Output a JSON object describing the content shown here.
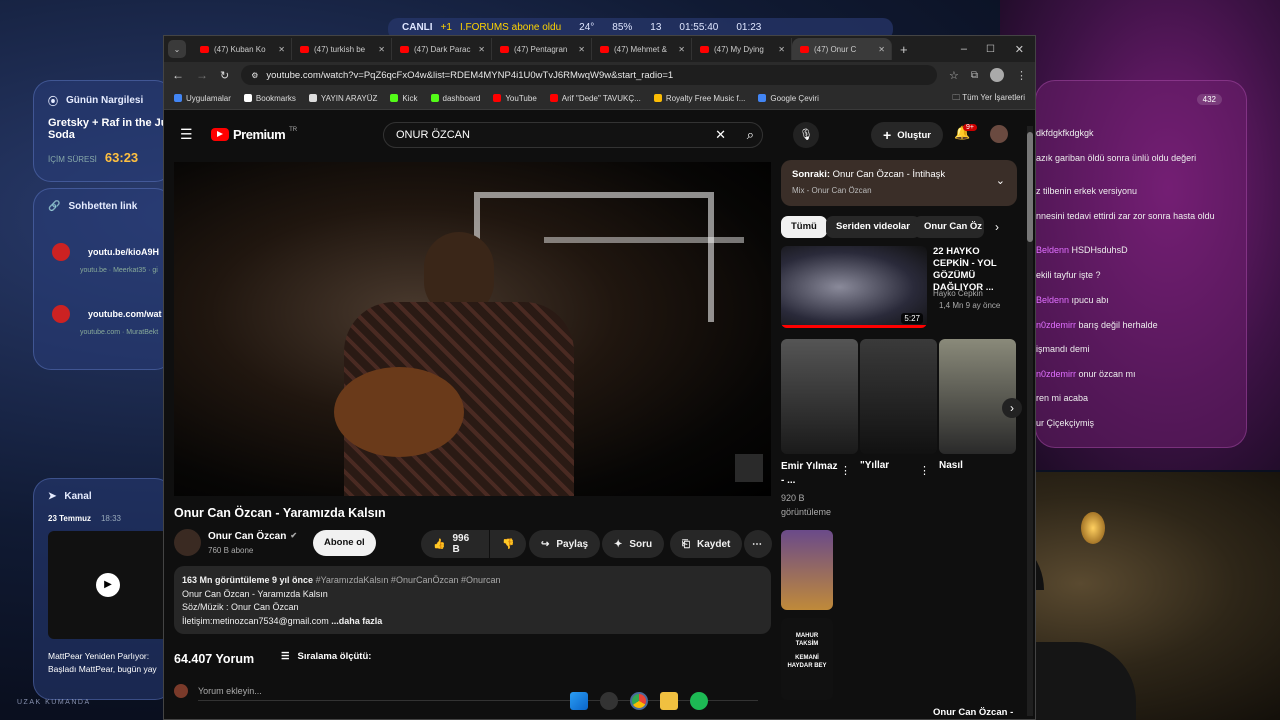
{
  "topbar": {
    "live": "CANLI",
    "plus": "+1",
    "follow": "I.FORUMS abone oldu",
    "temp": "24°",
    "humidity": "85%",
    "viewers": "13",
    "time1": "01:55:40",
    "time2": "01:23"
  },
  "widget_nargile": {
    "title": "Günün Nargilesi",
    "text1": "Gretsky + Raf in the Ju",
    "text2": "Soda",
    "duration_label": "İÇİM SÜRESİ",
    "duration": "63:23"
  },
  "widget_links": {
    "title": "Sohbetten link",
    "items": [
      {
        "url": "youtu.be/kioA9H",
        "meta": "youtu.be · Meerkat35 · gi"
      },
      {
        "url": "youtube.com/wat",
        "meta": "youtube.com · MuratBekt"
      }
    ]
  },
  "widget_kanal": {
    "title": "Kanal",
    "date": "23 Temmuz",
    "time": "18:33",
    "text1": "MattPear Yeniden Parlıyor: ",
    "text2": "Başladı MattPear, bugün yay"
  },
  "bottom_label": "UZAK KUMANDA",
  "browser": {
    "tabs": [
      "(47) Kuban Ko",
      "(47) turkish be",
      "(47) Dark Parac",
      "(47) Pentagran",
      "(47) Mehmet &",
      "(47) My Dying",
      "(47) Onur C"
    ],
    "url": "youtube.com/watch?v=PqZ6qcFxO4w&list=RDEM4MYNP4i1U0wTvJ6RMwqW9w&start_radio=1",
    "bookmarks": [
      "Uygulamalar",
      "Bookmarks",
      "YAYIN ARAYÜZ",
      "Kick",
      "dashboard",
      "YouTube",
      "Arif \"Dede\" TAVUKÇ...",
      "Royalty Free Music f...",
      "Google Çeviri"
    ],
    "all_bookmarks": "Tüm Yer İşaretleri"
  },
  "youtube": {
    "logo": "Premium",
    "logo_tr": "TR",
    "search_value": "ONUR ÖZCAN",
    "create": "Oluştur",
    "notif": "9+",
    "title": "Onur Can Özcan - Yaramızda Kalsın",
    "channel": "Onur Can Özcan",
    "subs": "760 B abone",
    "subscribe": "Abone ol",
    "likes": "996 B",
    "share": "Paylaş",
    "ask": "Soru",
    "save": "Kaydet",
    "desc_stats": "163 Mn görüntüleme  9 yıl önce",
    "desc_tags": "#YaramızdaKalsın #OnurCanÖzcan #Onurcan",
    "desc_lines": [
      "Onur Can Özcan - Yaramızda Kalsın",
      "Söz/Müzik : Onur Can Özcan",
      "İletişim:metinozcan7534@gmail.com"
    ],
    "desc_more": "...daha fazla",
    "comments_count": "64.407 Yorum",
    "sort": "Sıralama ölçütü:",
    "add_comment": "Yorum ekleyin...",
    "next_label": "Sonraki:",
    "next_title": "Onur Can Özcan - İntihaşk",
    "mix": "Mix - Onur Can Özcan",
    "chips": [
      "Tümü",
      "Seriden videolar",
      "Onur Can Öz"
    ],
    "rec1": {
      "title": "22 HAYKO CEPKİN - YOL GÖZÜMÜ DAĞLIYOR ...",
      "channel": "Hayko Cepkin",
      "meta": "1,4 Mn  9 ay önce",
      "duration": "5:27"
    },
    "shorts": [
      {
        "title": "Emir Yılmaz - ...",
        "views": "920 B görüntüleme"
      },
      {
        "title": "\"Yıllar",
        "views": ""
      },
      {
        "title": "Nasıl",
        "views": ""
      }
    ],
    "rec_bottom": "Onur Can Özcan -",
    "mahur": "MAHUR TAKSİM",
    "kemani": "KEMANİ HAYDAR BEY"
  },
  "chat": {
    "count": "432",
    "messages": [
      {
        "user": "",
        "text": "dkfdgkfkdgkgk"
      },
      {
        "user": "",
        "text": "azık gariban öldü sonra ünlü oldu değeri"
      },
      {
        "user": "",
        "text": "z tilbenin erkek versiyonu"
      },
      {
        "user": "",
        "text": "nnesini tedavi ettirdi zar zor sonra hasta oldu"
      },
      {
        "user": "Beldenn",
        "text": "HSDHsduhsD"
      },
      {
        "user": "",
        "text": "ekili tayfur işte ?"
      },
      {
        "user": "Beldenn",
        "text": "ıpucu abı"
      },
      {
        "user": "n0zdemirr",
        "text": "barış değil herhalde"
      },
      {
        "user": "",
        "text": "işmandı demi"
      },
      {
        "user": "n0zdemirr",
        "text": "onur özcan mı"
      },
      {
        "user": "",
        "text": "ren mi acaba"
      },
      {
        "user": "",
        "text": "ur Çiçekçiymiş"
      }
    ]
  }
}
